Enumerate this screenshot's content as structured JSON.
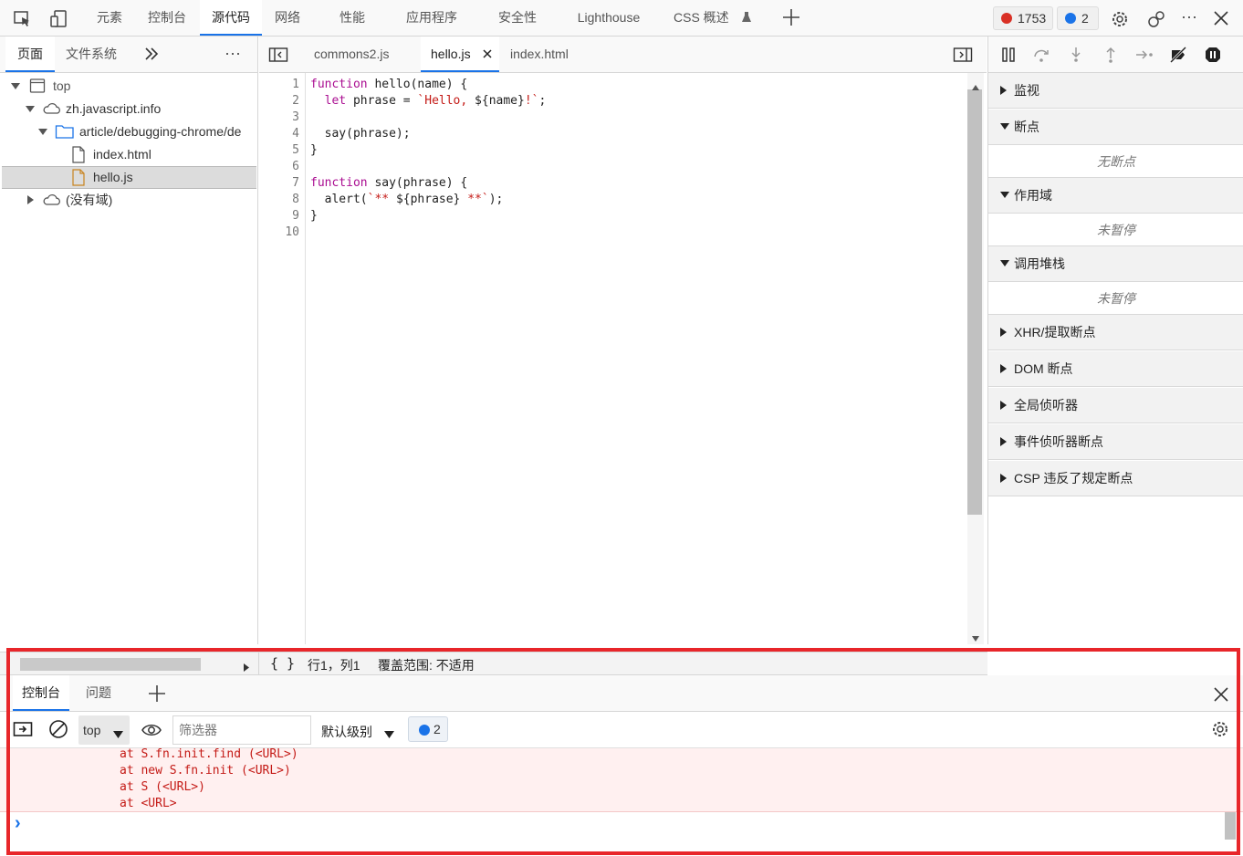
{
  "top_tabs": [
    "元素",
    "控制台",
    "源代码",
    "网络",
    "性能",
    "应用程序",
    "安全性",
    "Lighthouse",
    "CSS 概述"
  ],
  "top_active_tab": "源代码",
  "error_count": "1753",
  "message_count": "2",
  "colors": {
    "accent": "#1a73e8",
    "error": "#d93025",
    "highlight": "#e8262a",
    "keyword": "#aa0d91",
    "string": "#c41a16"
  },
  "left": {
    "tabs": [
      "页面",
      "文件系统"
    ],
    "tree": [
      {
        "label": "top",
        "icon": "frame-icon",
        "expanded": true
      },
      {
        "label": "zh.javascript.info",
        "icon": "cloud-icon",
        "expanded": true
      },
      {
        "label": "article/debugging-chrome/de",
        "icon": "folder-icon",
        "expanded": true
      },
      {
        "label": "index.html",
        "icon": "file-icon"
      },
      {
        "label": "hello.js",
        "icon": "js-file-icon",
        "selected": true
      },
      {
        "label": "(没有域)",
        "icon": "cloud-icon",
        "expanded": false
      }
    ]
  },
  "editor": {
    "tabs": [
      "commons2.js",
      "hello.js",
      "index.html"
    ],
    "active_tab": "hello.js",
    "lines": [
      "1",
      "2",
      "3",
      "4",
      "5",
      "6",
      "7",
      "8",
      "9",
      "10"
    ]
  },
  "right": {
    "sections": [
      {
        "label": "监视",
        "expanded": false
      },
      {
        "label": "断点",
        "expanded": true,
        "empty": "无断点"
      },
      {
        "label": "作用域",
        "expanded": true,
        "empty": "未暂停"
      },
      {
        "label": "调用堆栈",
        "expanded": true,
        "empty": "未暂停"
      },
      {
        "label": "XHR/提取断点",
        "expanded": false
      },
      {
        "label": "DOM 断点",
        "expanded": false
      },
      {
        "label": "全局侦听器",
        "expanded": false
      },
      {
        "label": "事件侦听器断点",
        "expanded": false
      },
      {
        "label": "CSP 违反了规定断点",
        "expanded": false
      }
    ]
  },
  "status": {
    "braces": "{ }",
    "position": "行1，列1",
    "coverage": "覆盖范围: 不适用"
  },
  "drawer": {
    "tabs": [
      "控制台",
      "问题"
    ],
    "context": "top",
    "filter_placeholder": "筛选器",
    "level": "默认级别",
    "msg_badge": "2",
    "errors": [
      "at S.fn.init.find (<URL>)",
      "at new S.fn.init (<URL>)",
      "at S (<URL>)",
      "at <URL>"
    ],
    "prompt": "›"
  }
}
